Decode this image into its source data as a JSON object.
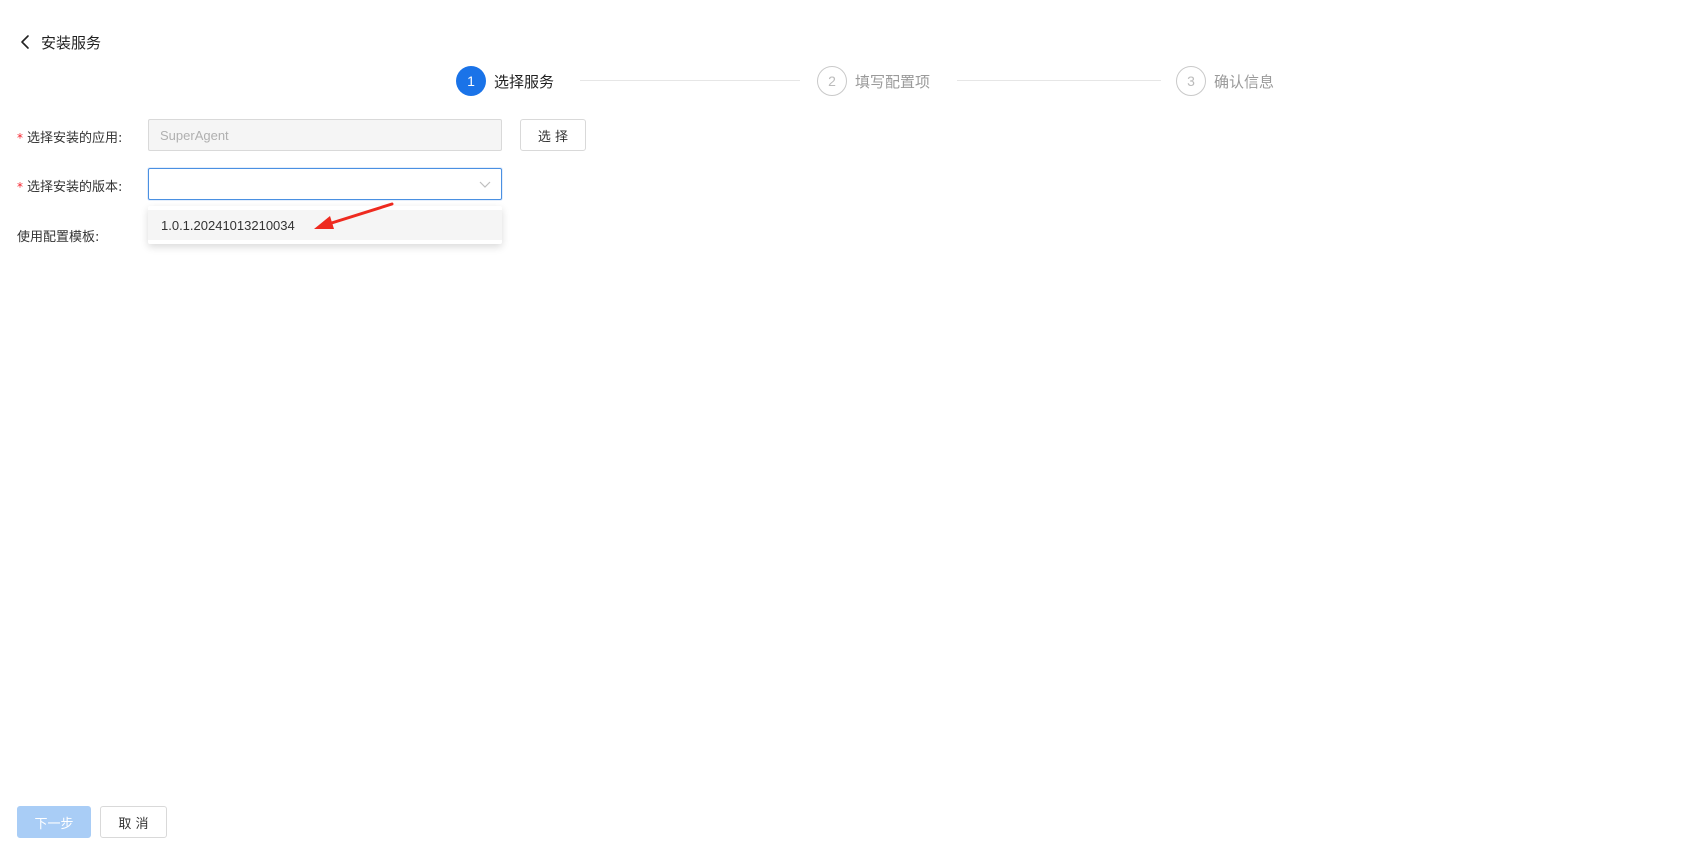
{
  "header": {
    "title": "安装服务",
    "back_icon": "chevron-left-icon"
  },
  "steps": [
    {
      "number": "1",
      "label": "选择服务",
      "status": "active"
    },
    {
      "number": "2",
      "label": "填写配置项",
      "status": "inactive"
    },
    {
      "number": "3",
      "label": "确认信息",
      "status": "inactive"
    }
  ],
  "form": {
    "app": {
      "label": "选择安装的应用:",
      "required_mark": "*",
      "value": "SuperAgent",
      "select_button": "选 择"
    },
    "version": {
      "label": "选择安装的版本:",
      "required_mark": "*",
      "value": "",
      "options": [
        "1.0.1.20241013210034"
      ]
    },
    "template": {
      "label": "使用配置模板:"
    }
  },
  "footer": {
    "next_label": "下一步",
    "cancel_label": "取 消"
  },
  "colors": {
    "primary": "#1a73e8",
    "primary_disabled": "#a9cdf6",
    "required": "#f5222d",
    "annotation_arrow": "#ee2a1f"
  }
}
